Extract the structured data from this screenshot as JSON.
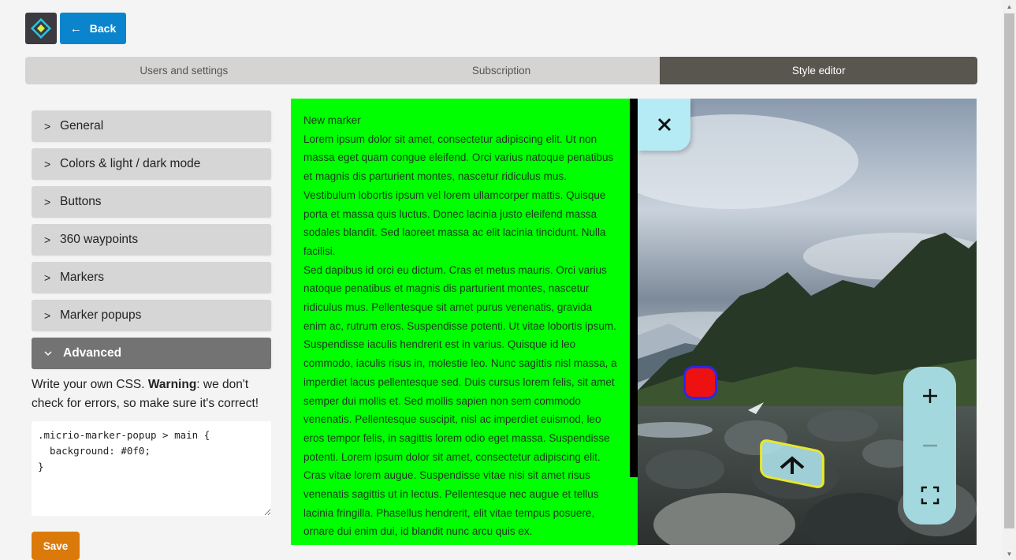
{
  "header": {
    "logo_icon": "diamond-logo-icon",
    "back_label": "Back",
    "back_icon": "arrow-left-icon"
  },
  "tabs": [
    {
      "label": "Users and settings",
      "active": false
    },
    {
      "label": "Subscription",
      "active": false
    },
    {
      "label": "Style editor",
      "active": true
    }
  ],
  "sidebar": {
    "sections": [
      {
        "label": "General",
        "expanded": false
      },
      {
        "label": "Colors & light / dark mode",
        "expanded": false
      },
      {
        "label": "Buttons",
        "expanded": false
      },
      {
        "label": "360 waypoints",
        "expanded": false
      },
      {
        "label": "Markers",
        "expanded": false
      },
      {
        "label": "Marker popups",
        "expanded": false
      },
      {
        "label": "Advanced",
        "expanded": true
      }
    ],
    "advanced": {
      "desc_prefix": "Write your own CSS. ",
      "desc_bold": "Warning",
      "desc_suffix": ": we don't check for errors, so make sure it's correct!",
      "css_value": ".micrio-marker-popup > main {\n  background: #0f0;\n}"
    },
    "save_label": "Save"
  },
  "preview": {
    "popup": {
      "background": "#00ff00",
      "title": "New marker",
      "paragraphs": [
        "Lorem ipsum dolor sit amet, consectetur adipiscing elit. Ut non massa eget quam congue eleifend. Orci varius natoque penatibus et magnis dis parturient montes, nascetur ridiculus mus. Vestibulum lobortis ipsum vel lorem ullamcorper mattis. Quisque porta et massa quis luctus. Donec lacinia justo eleifend massa sodales blandit. Sed laoreet massa ac elit lacinia tincidunt. Nulla facilisi.",
        "Sed dapibus id orci eu dictum. Cras et metus mauris. Orci varius natoque penatibus et magnis dis parturient montes, nascetur ridiculus mus. Pellentesque sit amet purus venenatis, gravida enim ac, rutrum eros. Suspendisse potenti. Ut vitae lobortis ipsum. Suspendisse iaculis hendrerit est in varius. Quisque id leo commodo, iaculis risus in, molestie leo. Nunc sagittis nisl massa, a imperdiet lacus pellentesque sed. Duis cursus lorem felis, sit amet semper dui mollis et. Sed mollis sapien non sem commodo venenatis. Pellentesque suscipit, nisl ac imperdiet euismod, leo eros tempor felis, in sagittis lorem odio eget massa. Suspendisse potenti. Lorem ipsum dolor sit amet, consectetur adipiscing elit.",
        "Cras vitae lorem augue. Suspendisse vitae nisi sit amet risus venenatis sagittis ut in lectus. Pellentesque nec augue et tellus lacinia fringilla. Phasellus hendrerit, elit vitae tempus posuere, ornare dui enim dui, id blandit nunc arcu quis ex."
      ]
    },
    "close_icon": "close-icon",
    "marker_color": "#ee1111",
    "marker_border": "#2a2ae8",
    "waypoint_icon": "arrow-up-icon",
    "controls": {
      "zoom_in_icon": "plus-icon",
      "zoom_out_icon": "minus-icon",
      "fullscreen_icon": "fullscreen-icon"
    }
  },
  "colors": {
    "accent_blue": "#0a84cc",
    "save_orange": "#db7a0a",
    "active_tab": "#59554f",
    "controls_bg": "#a3d9de"
  }
}
